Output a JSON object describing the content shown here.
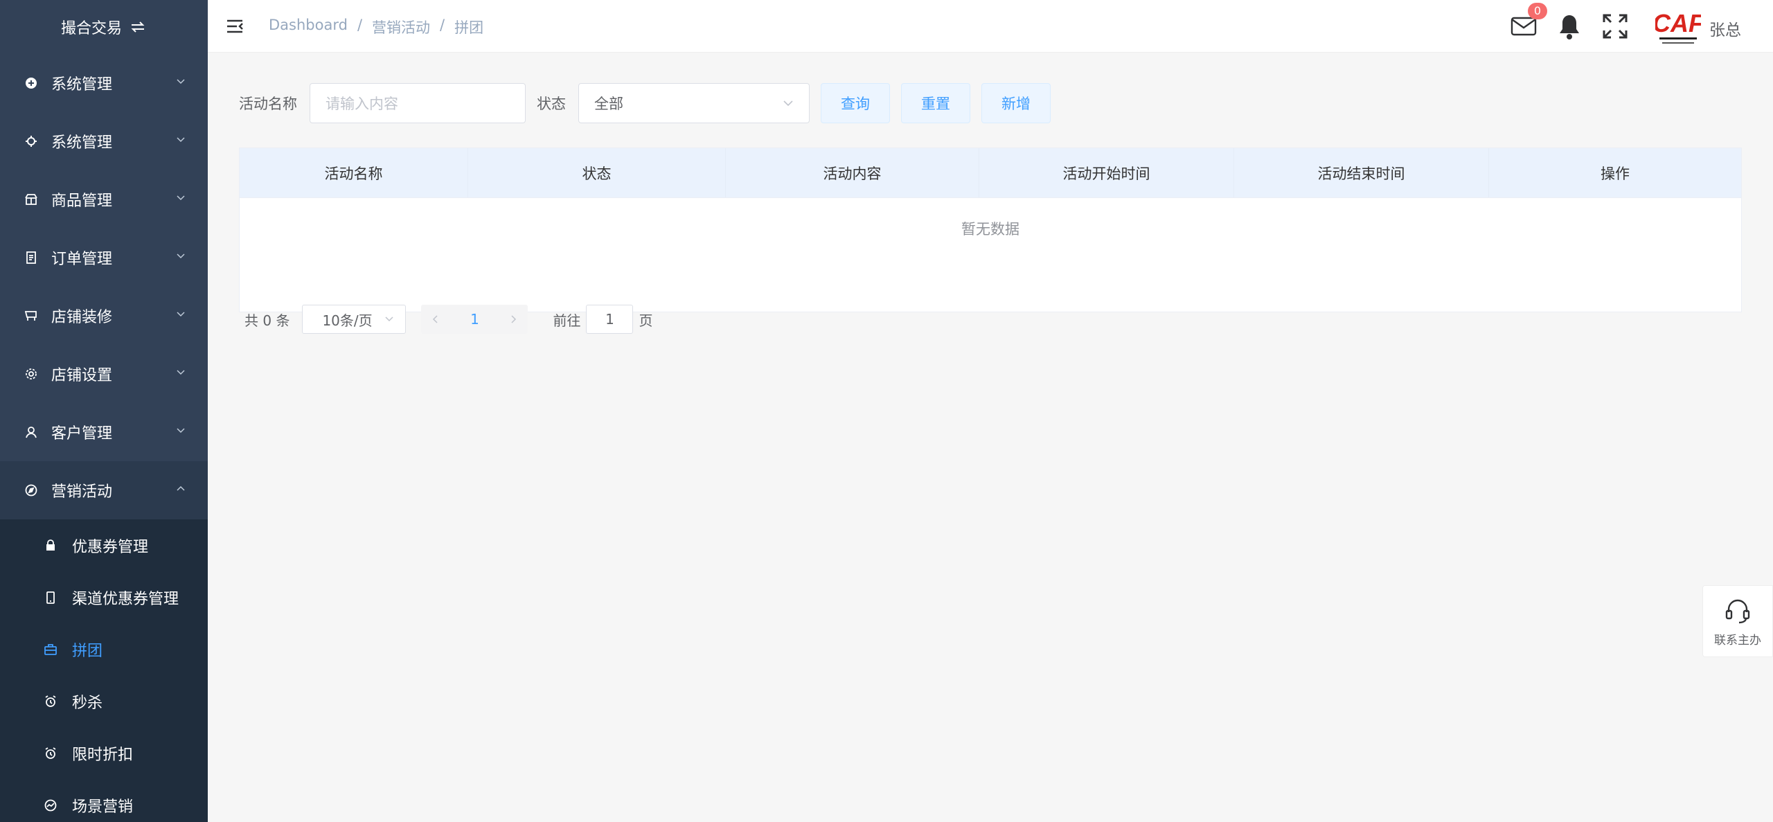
{
  "sidebar": {
    "brand": "撮合交易",
    "menu": [
      {
        "label": "系统管理",
        "icon": "plus-circle-icon"
      },
      {
        "label": "系统管理",
        "icon": "gear-icon"
      },
      {
        "label": "商品管理",
        "icon": "shop-icon"
      },
      {
        "label": "订单管理",
        "icon": "document-icon"
      },
      {
        "label": "店铺装修",
        "icon": "cart-icon"
      },
      {
        "label": "店铺设置",
        "icon": "settings-icon"
      },
      {
        "label": "客户管理",
        "icon": "user-icon"
      },
      {
        "label": "营销活动",
        "icon": "compass-icon"
      }
    ],
    "submenu": [
      {
        "label": "优惠券管理",
        "icon": "bag-icon"
      },
      {
        "label": "渠道优惠券管理",
        "icon": "phone-icon"
      },
      {
        "label": "拼团",
        "icon": "briefcase-icon"
      },
      {
        "label": "秒杀",
        "icon": "alarm-icon"
      },
      {
        "label": "限时折扣",
        "icon": "alarm-icon"
      },
      {
        "label": "场景营销",
        "icon": "chart-icon"
      }
    ]
  },
  "header": {
    "breadcrumb": [
      "Dashboard",
      "营销活动",
      "拼团"
    ],
    "mail_count": "0",
    "username": "张总",
    "logo_text": "CAF"
  },
  "filter": {
    "name_label": "活动名称",
    "name_placeholder": "请输入内容",
    "status_label": "状态",
    "status_value": "全部",
    "query_button": "查询",
    "reset_button": "重置",
    "add_button": "新增"
  },
  "table": {
    "columns": [
      "活动名称",
      "状态",
      "活动内容",
      "活动开始时间",
      "活动结束时间",
      "操作"
    ],
    "empty_text": "暂无数据"
  },
  "pagination": {
    "total_text": "共 0 条",
    "page_size": "10条/页",
    "current_page": "1",
    "goto_prefix": "前往",
    "goto_value": "1",
    "goto_suffix": "页"
  },
  "contact": {
    "label": "联系主办"
  },
  "colors": {
    "sidebar_bg": "#324157",
    "submenu_bg": "#1f2d3d",
    "accent": "#409eff",
    "badge": "#f56c6c"
  }
}
